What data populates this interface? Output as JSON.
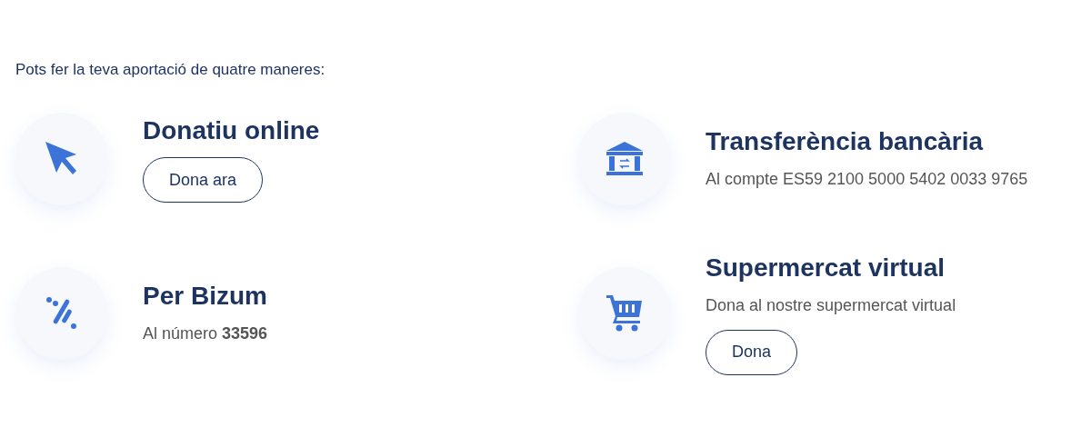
{
  "intro": "Pots fer la teva aportació de quatre maneres:",
  "methods": [
    {
      "kind": "cursor",
      "title": "Donatiu online",
      "button": "Dona ara"
    },
    {
      "kind": "bank",
      "title": "Transferència bancària",
      "text": "Al compte ES59 2100 5000 5402 0033 9765"
    },
    {
      "kind": "bizum",
      "title": "Per Bizum",
      "text": "Al número **33596**"
    },
    {
      "kind": "cart",
      "title": "Supermercat virtual",
      "text": "Dona al nostre supermercat virtual",
      "button": "Dona"
    }
  ]
}
